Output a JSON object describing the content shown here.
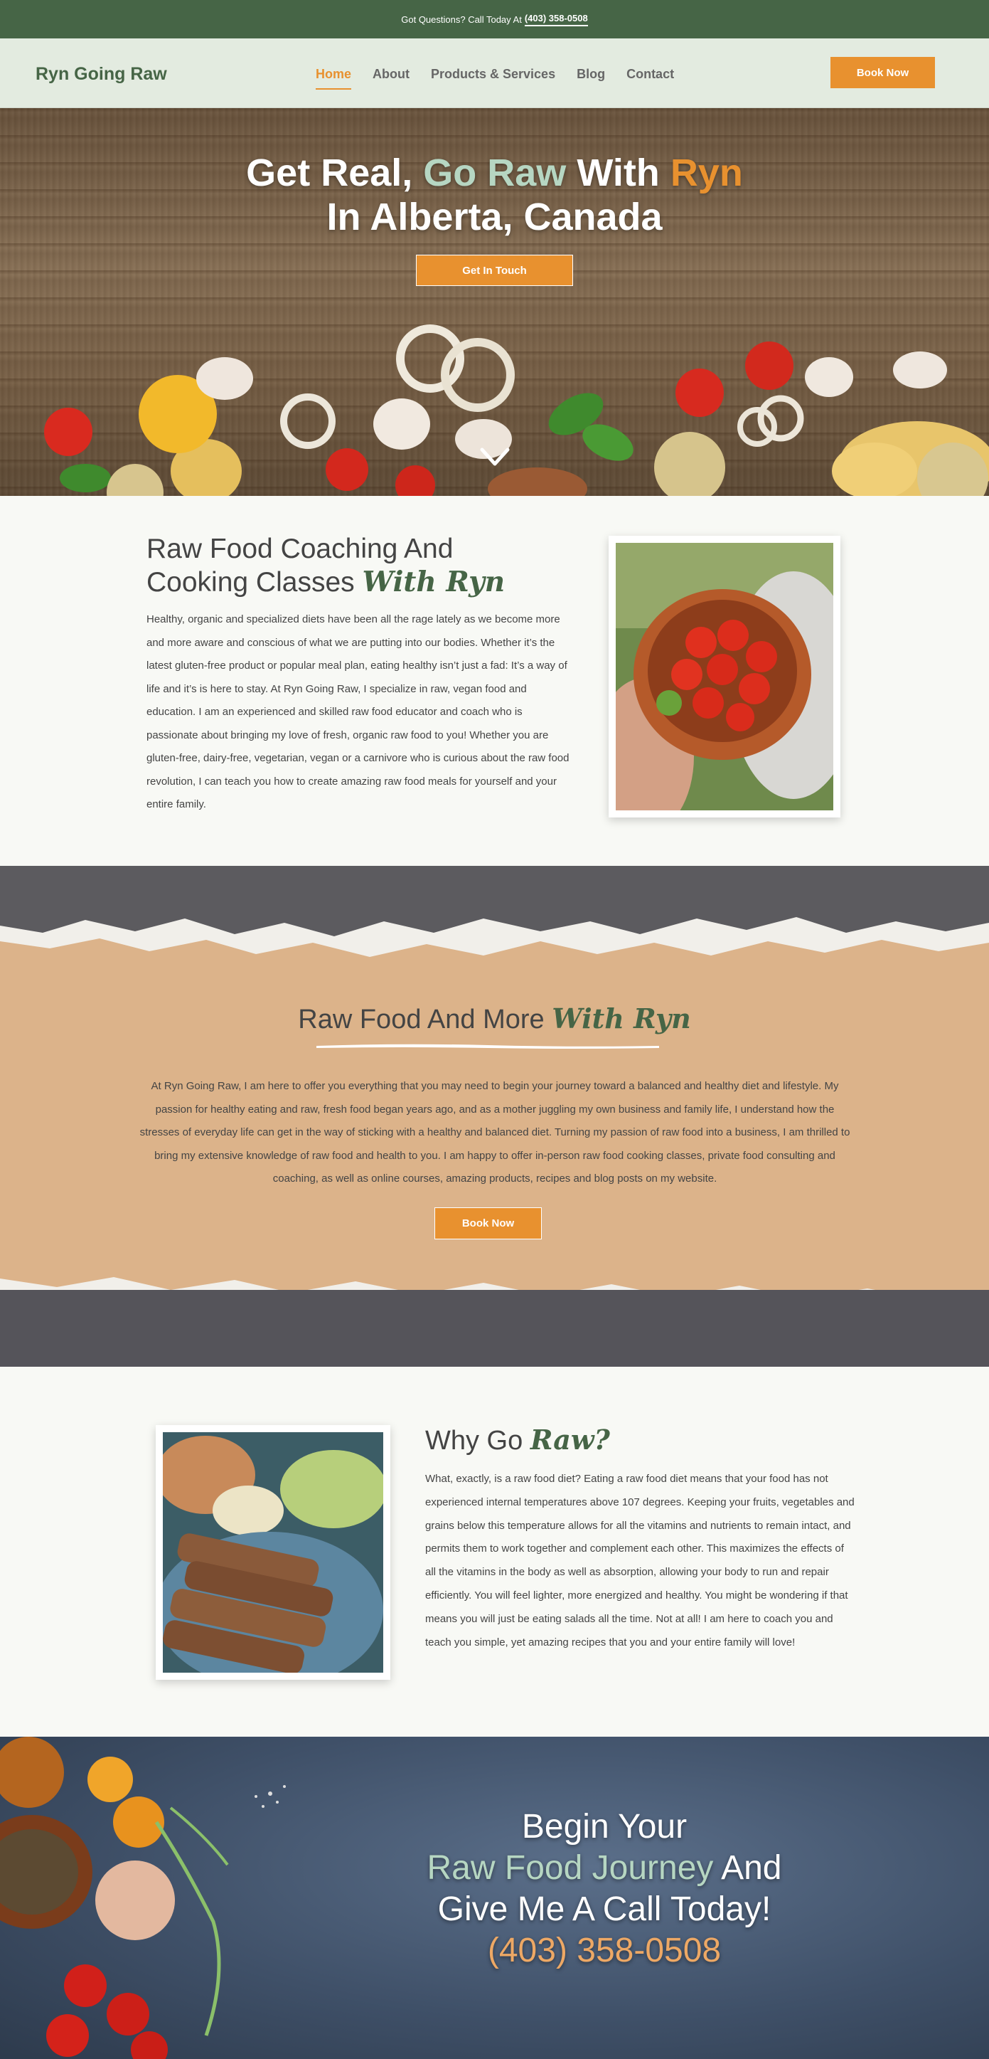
{
  "topbar": {
    "text": "Got Questions? Call Today At",
    "phone": "(403) 358-0508"
  },
  "header": {
    "logo": "Ryn Going Raw",
    "nav": [
      {
        "label": "Home",
        "active": true
      },
      {
        "label": "About",
        "active": false
      },
      {
        "label": "Products & Services",
        "active": false
      },
      {
        "label": "Blog",
        "active": false
      },
      {
        "label": "Contact",
        "active": false
      }
    ],
    "book_button": "Book Now"
  },
  "hero": {
    "title_part1": "Get Real,",
    "title_green": "Go Raw",
    "title_part2": "With",
    "title_orange": "Ryn",
    "title_line2": "In Alberta, Canada",
    "button": "Get In Touch",
    "scroll_icon": "chevron-down-icon"
  },
  "coaching": {
    "title_line1": "Raw Food Coaching And",
    "title_line2": "Cooking Classes",
    "title_script": "With Ryn",
    "body": "Healthy, organic and specialized diets have been all the rage lately as we become more and more aware and conscious of what we are putting into our bodies. Whether it’s the latest gluten-free product or popular meal plan, eating healthy isn’t just a fad: It’s a way of life and it’s is here to stay. At Ryn Going Raw, I specialize in raw, vegan food and education. I am an experienced and skilled raw food educator and coach who is passionate about bringing my love of fresh, organic raw food to you! Whether you are gluten-free, dairy-free, vegetarian, vegan or a carnivore who is curious about the raw food revolution, I can teach you how to create amazing raw food meals for yourself and your entire family."
  },
  "more": {
    "title": "Raw Food And More",
    "title_script": "With Ryn",
    "body": "At Ryn Going Raw, I am here to offer you everything that you may need to begin your journey toward a balanced and healthy diet and lifestyle. My passion for healthy eating and raw, fresh food began years ago, and as a mother juggling my own business and family life, I understand how the stresses of everyday life can get in the way of sticking with a healthy and balanced diet. Turning my passion of raw food into a business, I am thrilled to bring my extensive knowledge of raw food and health to you. I am happy to offer in-person raw food cooking classes, private food consulting and coaching, as well as online courses, amazing products, recipes and blog posts on my website.",
    "button": "Book Now"
  },
  "why": {
    "title": "Why Go",
    "title_script": "Raw?",
    "body": "What, exactly, is a raw food diet? Eating a raw food diet means that your food has not experienced internal temperatures above 107 degrees. Keeping your fruits, vegetables and grains below this temperature allows for all the vitamins and nutrients to remain intact, and permits them to work together and complement each other. This maximizes the effects of all the vitamins in the body as well as absorption, allowing your body to run and repair efficiently. You will feel lighter, more energized and healthy. You might be wondering if that means you will just be eating salads all the time. Not at all! I am here to coach you and teach you simple, yet amazing recipes that you and your entire family will love!"
  },
  "cta": {
    "line1": "Begin Your",
    "line2_green": "Raw Food Journey",
    "line2_rest": "And",
    "line3": "Give Me A Call Today!",
    "phone": "(403) 358-0508"
  },
  "colors": {
    "brand_green": "#466546",
    "accent_orange": "#e8912f",
    "light_green": "#b6d6c2",
    "tan": "#dcb38a"
  }
}
